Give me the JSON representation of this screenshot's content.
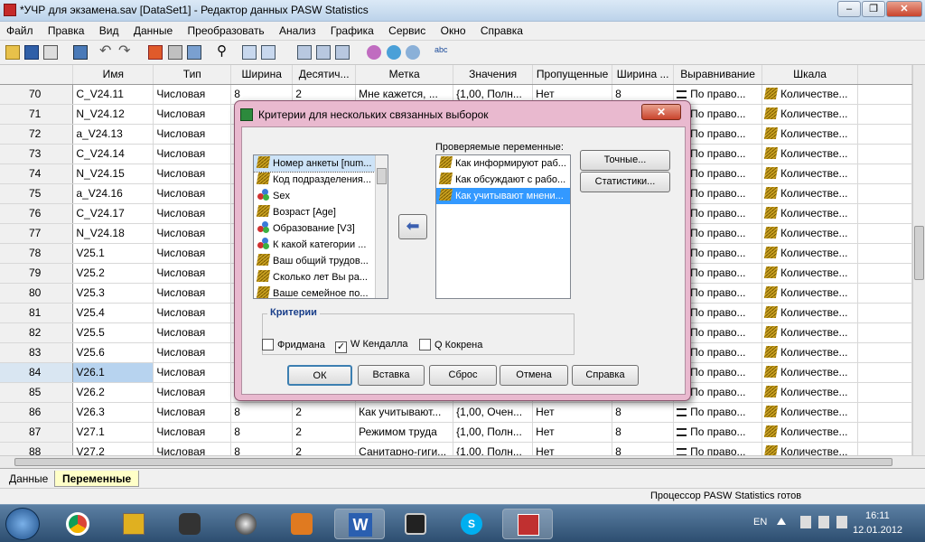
{
  "window": {
    "title": "*УЧР для экзамена.sav [DataSet1] - Редактор данных PASW Statistics",
    "min": "‒",
    "max": "❐",
    "close": "✕"
  },
  "menu": [
    "Файл",
    "Правка",
    "Вид",
    "Данные",
    "Преобразовать",
    "Анализ",
    "Графика",
    "Сервис",
    "Окно",
    "Справка"
  ],
  "grid": {
    "headers": [
      "Имя",
      "Тип",
      "Ширина",
      "Десятич...",
      "Метка",
      "Значения",
      "Пропущенные",
      "Ширина ...",
      "Выравнивание",
      "Шкала"
    ],
    "rows": [
      {
        "n": "70",
        "name": "C_V24.11",
        "type": "Числовая",
        "width": "8",
        "dec": "2",
        "label": "Мне кажется, ...",
        "values": "{1,00, Полн...",
        "missing": "Нет",
        "colw": "8",
        "align": "По право...",
        "scale": "Количестве..."
      },
      {
        "n": "71",
        "name": "N_V24.12",
        "type": "Числовая",
        "width": "",
        "dec": "",
        "label": "",
        "values": "",
        "missing": "",
        "colw": "",
        "align": "По право...",
        "scale": "Количестве..."
      },
      {
        "n": "72",
        "name": "a_V24.13",
        "type": "Числовая",
        "width": "",
        "dec": "",
        "label": "",
        "values": "",
        "missing": "",
        "colw": "",
        "align": "По право...",
        "scale": "Количестве..."
      },
      {
        "n": "73",
        "name": "C_V24.14",
        "type": "Числовая",
        "width": "",
        "dec": "",
        "label": "",
        "values": "",
        "missing": "",
        "colw": "",
        "align": "По право...",
        "scale": "Количестве..."
      },
      {
        "n": "74",
        "name": "N_V24.15",
        "type": "Числовая",
        "width": "",
        "dec": "",
        "label": "",
        "values": "",
        "missing": "",
        "colw": "",
        "align": "По право...",
        "scale": "Количестве..."
      },
      {
        "n": "75",
        "name": "a_V24.16",
        "type": "Числовая",
        "width": "",
        "dec": "",
        "label": "",
        "values": "",
        "missing": "",
        "colw": "",
        "align": "По право...",
        "scale": "Количестве..."
      },
      {
        "n": "76",
        "name": "C_V24.17",
        "type": "Числовая",
        "width": "",
        "dec": "",
        "label": "",
        "values": "",
        "missing": "",
        "colw": "",
        "align": "По право...",
        "scale": "Количестве..."
      },
      {
        "n": "77",
        "name": "N_V24.18",
        "type": "Числовая",
        "width": "",
        "dec": "",
        "label": "",
        "values": "",
        "missing": "",
        "colw": "",
        "align": "По право...",
        "scale": "Количестве..."
      },
      {
        "n": "78",
        "name": "V25.1",
        "type": "Числовая",
        "width": "",
        "dec": "",
        "label": "",
        "values": "",
        "missing": "",
        "colw": "",
        "align": "По право...",
        "scale": "Количестве..."
      },
      {
        "n": "79",
        "name": "V25.2",
        "type": "Числовая",
        "width": "",
        "dec": "",
        "label": "",
        "values": "",
        "missing": "",
        "colw": "",
        "align": "По право...",
        "scale": "Количестве..."
      },
      {
        "n": "80",
        "name": "V25.3",
        "type": "Числовая",
        "width": "",
        "dec": "",
        "label": "",
        "values": "",
        "missing": "",
        "colw": "",
        "align": "По право...",
        "scale": "Количестве..."
      },
      {
        "n": "81",
        "name": "V25.4",
        "type": "Числовая",
        "width": "",
        "dec": "",
        "label": "",
        "values": "",
        "missing": "",
        "colw": "",
        "align": "По право...",
        "scale": "Количестве..."
      },
      {
        "n": "82",
        "name": "V25.5",
        "type": "Числовая",
        "width": "",
        "dec": "",
        "label": "",
        "values": "",
        "missing": "",
        "colw": "",
        "align": "По право...",
        "scale": "Количестве..."
      },
      {
        "n": "83",
        "name": "V25.6",
        "type": "Числовая",
        "width": "",
        "dec": "",
        "label": "",
        "values": "",
        "missing": "",
        "colw": "",
        "align": "По право...",
        "scale": "Количестве..."
      },
      {
        "n": "84",
        "name": "V26.1",
        "type": "Числовая",
        "width": "",
        "dec": "",
        "label": "",
        "values": "",
        "missing": "",
        "colw": "",
        "align": "По право...",
        "scale": "Количестве..."
      },
      {
        "n": "85",
        "name": "V26.2",
        "type": "Числовая",
        "width": "",
        "dec": "",
        "label": "",
        "values": "",
        "missing": "",
        "colw": "",
        "align": "По право...",
        "scale": "Количестве..."
      },
      {
        "n": "86",
        "name": "V26.3",
        "type": "Числовая",
        "width": "8",
        "dec": "2",
        "label": "Как учитывают...",
        "values": "{1,00, Очен...",
        "missing": "Нет",
        "colw": "8",
        "align": "По право...",
        "scale": "Количестве..."
      },
      {
        "n": "87",
        "name": "V27.1",
        "type": "Числовая",
        "width": "8",
        "dec": "2",
        "label": "Режимом труда",
        "values": "{1,00, Полн...",
        "missing": "Нет",
        "colw": "8",
        "align": "По право...",
        "scale": "Количестве..."
      },
      {
        "n": "88",
        "name": "V27.2",
        "type": "Числовая",
        "width": "8",
        "dec": "2",
        "label": "Санитарно-гиги...",
        "values": "{1,00, Полн...",
        "missing": "Нет",
        "colw": "8",
        "align": "По право...",
        "scale": "Количестве..."
      }
    ]
  },
  "tabs": {
    "data": "Данные",
    "vars": "Переменные"
  },
  "status": "Процессор PASW Statistics  готов",
  "dialog": {
    "title": "Критерии для нескольких связанных выборок",
    "close": "✕",
    "source_vars": [
      {
        "label": "Номер анкеты [num...",
        "icon": "scale"
      },
      {
        "label": "Код подразделения...",
        "icon": "scale"
      },
      {
        "label": "Sex",
        "icon": "nominal"
      },
      {
        "label": "Возраст [Age]",
        "icon": "scale"
      },
      {
        "label": "Образование [V3]",
        "icon": "nominal"
      },
      {
        "label": "К какой категории ...",
        "icon": "nominal"
      },
      {
        "label": "Ваш общий трудов...",
        "icon": "scale"
      },
      {
        "label": "Сколько лет Вы ра...",
        "icon": "scale"
      },
      {
        "label": "Ваше семейное по...",
        "icon": "scale"
      }
    ],
    "test_label": "Проверяемые переменные:",
    "test_vars": [
      "Как информируют раб...",
      "Как обсуждают с рабо...",
      "Как учитывают мнени..."
    ],
    "btn_exact": "Точные...",
    "btn_stats": "Статистики...",
    "criteria_legend": "Критерии",
    "cb_friedman": "Фридмана",
    "cb_kendall": "W Кендалла",
    "cb_cochran": "Q Кокрена",
    "btn_ok": "ОК",
    "btn_paste": "Вставка",
    "btn_reset": "Сброс",
    "btn_cancel": "Отмена",
    "btn_help": "Справка"
  },
  "tray": {
    "lang": "EN",
    "time": "16:11",
    "date": "12.01.2012"
  }
}
